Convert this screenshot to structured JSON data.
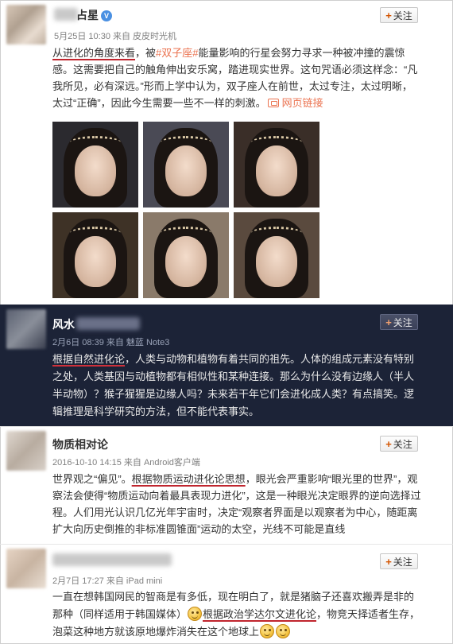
{
  "posts": [
    {
      "name_suffix": "占星",
      "verified_badge": "V",
      "meta": "5月25日 10:30 来自 皮皮时光机",
      "follow_plus": "+",
      "follow_label": "关注",
      "line1": {
        "highlight": "从进化的角度来看",
        "a": "，被",
        "tag": "#双子座#",
        "b": "能量影响的行星会努力寻求一种被冲撞的震惊"
      },
      "line2": "感。这需要把自己的触角伸出安乐窝，踏进现实世界。这句咒语必须这样念：“凡",
      "line3": "我所见，必有深远。”形而上学中认为，双子座人在前世，太过专注，太过明晰，",
      "line4": {
        "a": "太过“正确”，因此今生需要一些不一样的刺激。",
        "link_label": "网页链接"
      },
      "photo_grid": {
        "icon": "photo-grid-icon",
        "count": 6
      }
    },
    {
      "name_prefix": "风水",
      "meta": "2月6日 08:39 来自 魅蓝 Note3",
      "follow_plus": "+",
      "follow_label": "关注",
      "line1": {
        "highlight": "根据自然进化论",
        "a": "，人类与动物和植物有着共同的祖先。人体的组成元素没有特别"
      },
      "line2": "之处，人类基因与动植物都有相似性和某种连接。那么为什么没有边缘人（半人",
      "line3": "半动物）？猴子猩猩是边缘人吗？未来若干年它们会进化成人类？有点搞笑。逻",
      "line4": "辑推理是科学研究的方法，但不能代表事实。"
    },
    {
      "name": "物质相对论",
      "meta": "2016-10-10 14:15 来自 Android客户端",
      "follow_plus": "+",
      "follow_label": "关注",
      "line1": {
        "a": "世界观之“偏见”。",
        "highlight": "根据物质运动进化论思想",
        "b": "，眼光会严重影响“眼光里的世界”，观"
      },
      "line2": "察法会使得“物质运动向着最具表现力进化”，这是一种眼光决定眼界的逆向选择过",
      "line3": "程。人们用光认识几亿光年宇宙时，决定“观察者界面是以观察者为中心，随距离",
      "line4": "扩大向历史倒推的非标准圆锥面”运动的太空，光线不可能是直线"
    },
    {
      "meta": "2月7日 17:27 来自 iPad mini",
      "follow_plus": "+",
      "follow_label": "关注",
      "line1": "一直在想韩国网民的智商是有多低，现在明白了，就是猪脑子还喜欢搬弄是非的",
      "line2": {
        "a": "那种（同样适用于韩国媒体）",
        "highlight": "根据政治学达尔文进化论",
        "b": "，物竞天择适者生存，"
      },
      "line3": "泡菜这种地方就该原地爆炸消失在这个地球上"
    }
  ],
  "colors": {
    "accent_orange": "#eb7350",
    "underline_red": "#c0252e",
    "dark_bg": "#1c2337"
  }
}
